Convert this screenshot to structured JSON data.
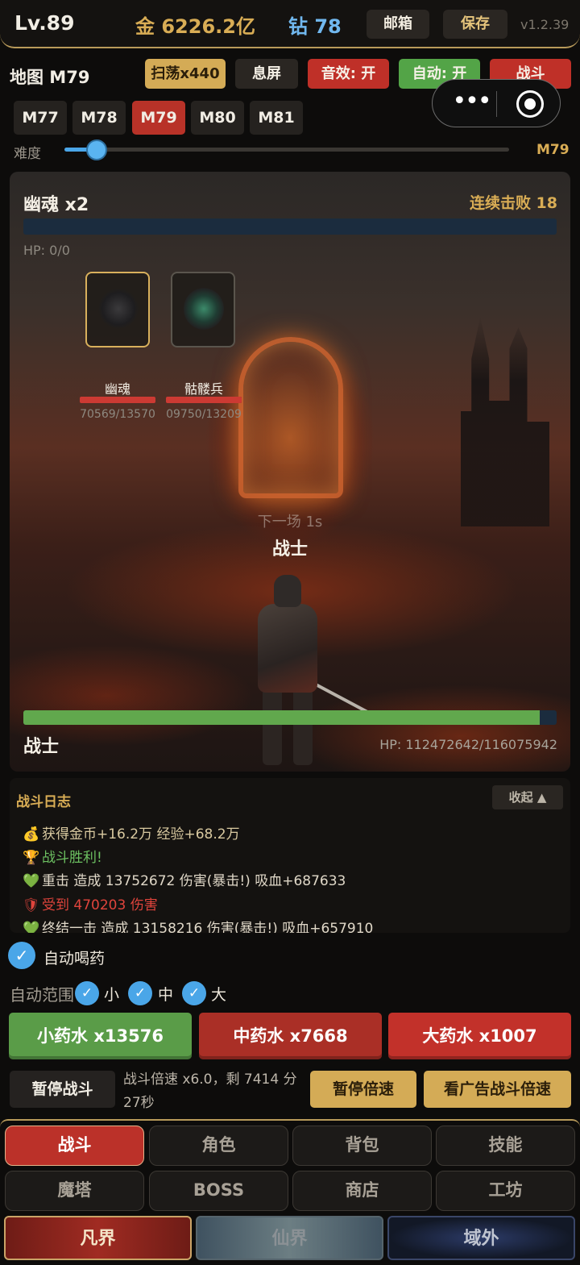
{
  "header": {
    "level": "Lv.89",
    "gold": "金 6226.2亿",
    "diamond": "钻 78",
    "mail_label": "邮箱",
    "save_label": "保存",
    "version": "v1.2.39"
  },
  "map": {
    "title": "地图 M79",
    "buttons": {
      "sweep": "扫荡x440",
      "screen_off": "息屏",
      "sound": "音效: 开",
      "auto": "自动: 开",
      "fight": "战斗"
    },
    "tabs": [
      "M77",
      "M78",
      "M79",
      "M80",
      "M81"
    ],
    "active_tab": "M79",
    "difficulty_label": "难度",
    "difficulty_value": "M79",
    "difficulty_fraction": 0.07
  },
  "battle": {
    "enemy_group": "幽魂 x2",
    "streak": "连续击败 18",
    "enemy_hp": "HP: 0/0",
    "enemies": [
      {
        "name": "幽魂",
        "hp": "70569/13570",
        "hp_fraction": 1.0
      },
      {
        "name": "骷髅兵",
        "hp": "09750/13209",
        "hp_fraction": 1.0
      }
    ],
    "next_round": "下一场 1s",
    "hero_center_name": "战士",
    "hero_name": "战士",
    "hero_hp": "HP: 112472642/116075942",
    "hero_hp_fraction": 0.969
  },
  "log": {
    "title": "战斗日志",
    "collapse_label": "收起 ▲",
    "lines": [
      {
        "icon": "money-bag-icon",
        "glyph": "💰",
        "text": "获得金币+16.2万 经验+68.2万"
      },
      {
        "icon": "trophy-icon",
        "glyph": "🏆",
        "text": "战斗胜利!"
      },
      {
        "icon": "green-heart-icon",
        "glyph": "💚",
        "text": "重击 造成 13752672 伤害(暴击!) 吸血+687633"
      },
      {
        "icon": "shield-icon",
        "glyph": "🛡",
        "text": "受到 470203 伤害"
      },
      {
        "icon": "green-heart-icon",
        "glyph": "💚",
        "text": "终结一击 造成 13158216 伤害(暴击!) 吸血+657910"
      }
    ]
  },
  "potions": {
    "auto_drink_label": "自动喝药",
    "range_label": "自动范围",
    "range_small": "小",
    "range_medium": "中",
    "range_large": "大",
    "small": "小药水 x13576",
    "medium": "中药水 x7668",
    "large": "大药水 x1007"
  },
  "speed": {
    "pause_label": "暂停战斗",
    "status": "战斗倍速 x6.0，剩 7414 分27秒",
    "pause_speed_label": "暂停倍速",
    "ad_speed_label": "看广告战斗倍速"
  },
  "nav": {
    "row1": [
      "战斗",
      "角色",
      "背包",
      "技能"
    ],
    "row2": [
      "魔塔",
      "BOSS",
      "商店",
      "工坊"
    ],
    "realms": [
      "凡界",
      "仙界",
      "域外"
    ]
  },
  "colors": {
    "accent_gold": "#d9ad55",
    "accent_red": "#bf3028",
    "accent_green": "#53a447",
    "accent_blue": "#4aa6e8"
  }
}
